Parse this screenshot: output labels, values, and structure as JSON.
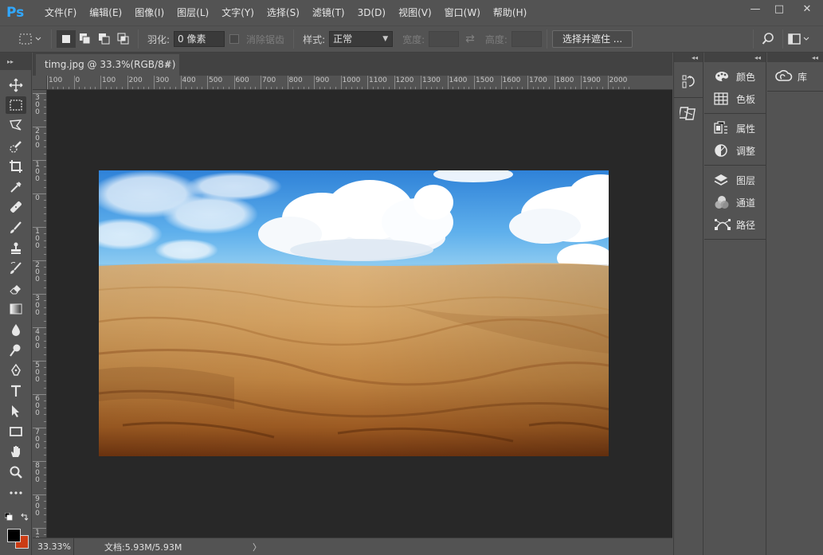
{
  "app": {
    "logo": "Ps"
  },
  "menu": [
    "文件(F)",
    "编辑(E)",
    "图像(I)",
    "图层(L)",
    "文字(Y)",
    "选择(S)",
    "滤镜(T)",
    "3D(D)",
    "视图(V)",
    "窗口(W)",
    "帮助(H)"
  ],
  "window_controls": {
    "minimize": "—",
    "maximize": "□",
    "close": "✕"
  },
  "options": {
    "feather_label": "羽化:",
    "feather_value": "0 像素",
    "antialias_label": "消除锯齿",
    "style_label": "样式:",
    "style_value": "正常",
    "width_label": "宽度:",
    "height_label": "高度:",
    "select_mask_button": "选择并遮住 ..."
  },
  "document": {
    "tab_title": "timg.jpg @ 33.3%(RGB/8#)",
    "tab_close": "×",
    "zoom": "33.33%",
    "doc_info": "文档:5.93M/5.93M",
    "status_arrow": "〉"
  },
  "ruler": {
    "h_labels": [
      "100",
      "0",
      "100",
      "200",
      "300",
      "400",
      "500",
      "600",
      "700",
      "800",
      "900",
      "1000",
      "1100",
      "1200",
      "1300",
      "1400",
      "1500",
      "1600",
      "1700",
      "1800",
      "1900",
      "2000"
    ],
    "v_labels": [
      "300",
      "200",
      "100",
      "0",
      "100",
      "200",
      "300",
      "400",
      "500",
      "600",
      "700",
      "800",
      "900",
      "1000"
    ]
  },
  "tools": [
    "move",
    "marquee",
    "lasso",
    "quick-selection",
    "crop",
    "eyedropper",
    "healing-brush",
    "brush",
    "clone-stamp",
    "history-brush",
    "eraser",
    "gradient",
    "blur",
    "dodge",
    "pen",
    "type",
    "path-selection",
    "rectangle",
    "hand",
    "zoom",
    "more"
  ],
  "panels": {
    "group1": [
      {
        "label": "颜色",
        "icon": "color-palette-icon"
      },
      {
        "label": "色板",
        "icon": "swatches-grid-icon"
      }
    ],
    "group2": [
      {
        "label": "属性",
        "icon": "properties-icon"
      },
      {
        "label": "调整",
        "icon": "adjustments-icon"
      }
    ],
    "group3": [
      {
        "label": "图层",
        "icon": "layers-icon"
      },
      {
        "label": "通道",
        "icon": "channels-icon"
      },
      {
        "label": "路径",
        "icon": "paths-icon"
      }
    ],
    "library": {
      "label": "库",
      "icon": "creative-cloud-icon"
    }
  },
  "colors": {
    "foreground": "#000000",
    "background": "#cc3c14",
    "ui_bg": "#535353",
    "canvas_bg": "#282828"
  },
  "image_description": "desert sand dunes under blue sky with white clouds"
}
